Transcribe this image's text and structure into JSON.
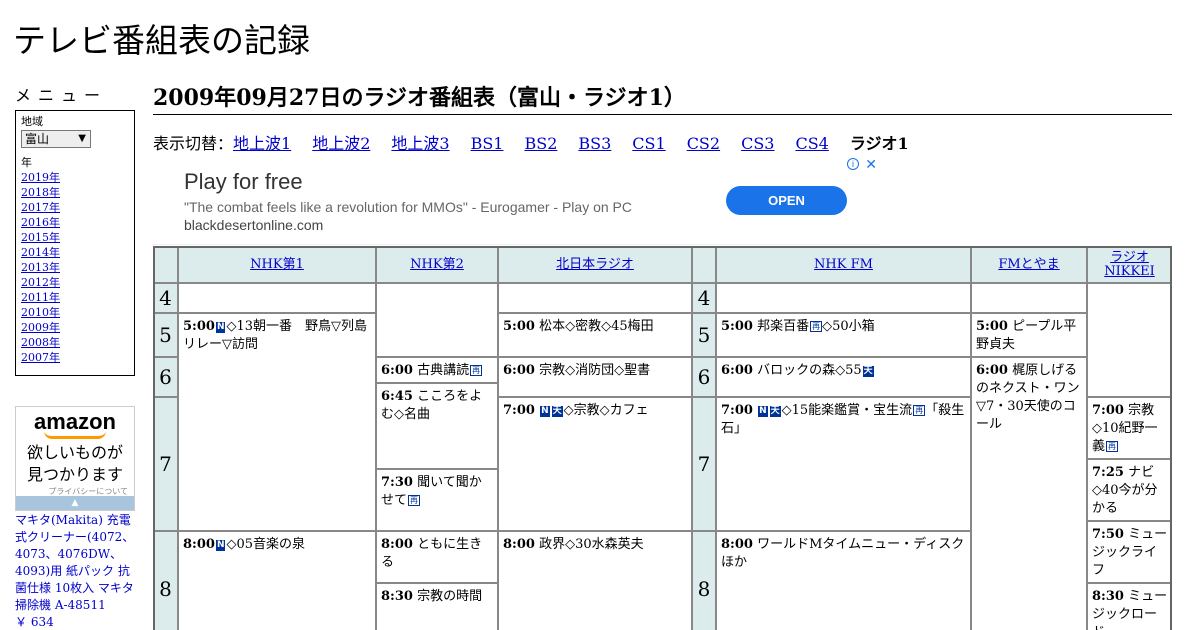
{
  "site": {
    "title": "テレビ番組表の記録"
  },
  "sidebar": {
    "menu_title": "メニュー",
    "region_label": "地域",
    "region_selected": "富山",
    "year_label": "年",
    "years": [
      "2019年",
      "2018年",
      "2017年",
      "2016年",
      "2015年",
      "2014年",
      "2013年",
      "2012年",
      "2011年",
      "2010年",
      "2009年",
      "2008年",
      "2007年"
    ]
  },
  "amazon_ad": {
    "logo": "amazon",
    "copy_line1": "欲しいものが",
    "copy_line2": "見つかります",
    "privacy": "プライバシーについて",
    "arrow": "▲"
  },
  "product": {
    "name": "マキタ(Makita) 充電式クリーナー(4072、4073、4076DW、4093)用 紙パック 抗菌仕様 10枚入 マキタ 掃除機 A-48511",
    "price": "￥ 634"
  },
  "main": {
    "heading": "2009年09月27日のラジオ番組表（富山・ラジオ1）",
    "switch_label": "表示切替：",
    "switch_links": [
      "地上波1",
      "地上波2",
      "地上波3",
      "BS1",
      "BS2",
      "BS3",
      "CS1",
      "CS2",
      "CS3",
      "CS4"
    ],
    "switch_current": "ラジオ1"
  },
  "ad_banner": {
    "title": "Play for free",
    "quote": "\"The combat feels like a revolution for MMOs\" - Eurogamer - Play on PC",
    "url": "blackdesertonline.com",
    "button": "OPEN",
    "info_icon": "i",
    "close_icon": "✕"
  },
  "schedule": {
    "channels": [
      "NHK第1",
      "NHK第2",
      "北日本ラジオ",
      "NHK FM",
      "FMとやま",
      "ラジオNIKKEI"
    ],
    "channel_ni_line1": "ラジオ",
    "channel_ni_line2": "NIKKEI",
    "hours": [
      "4",
      "5",
      "6",
      "7",
      "8"
    ],
    "icons": {
      "news": "N",
      "weather": "天",
      "rerun": "再"
    },
    "programs": {
      "nhk1_500_time": "5:00",
      "nhk1_500_text": "◇13朝一番　野鳥▽列島リレー▽訪問",
      "nhk1_800_time": "8:00",
      "nhk1_800_text": "◇05音楽の泉",
      "nhk2_600_time": "6:00",
      "nhk2_600_text": "古典講読",
      "nhk2_645_time": "6:45",
      "nhk2_645_text": "こころをよむ◇名曲",
      "nhk2_730_time": "7:30",
      "nhk2_730_text": "聞いて聞かせて",
      "nhk2_800_time": "8:00",
      "nhk2_800_text": "ともに生きる",
      "nhk2_830_time": "8:30",
      "nhk2_830_text": "宗教の時間",
      "kn_500_time": "5:00",
      "kn_500_text": "松本◇密教◇45梅田",
      "kn_600_time": "6:00",
      "kn_600_text": "宗教◇消防団◇聖書",
      "kn_700_time": "7:00",
      "kn_700_text": "◇宗教◇カフェ",
      "kn_800_time": "8:00",
      "kn_800_text": "政界◇30水森英夫",
      "fm_500_time": "5:00",
      "fm_500_text": "邦楽百番",
      "fm_500_text2": "◇50小箱",
      "fm_600_time": "6:00",
      "fm_600_text": "バロックの森◇55",
      "fm_700_time": "7:00",
      "fm_700_text": "◇15能楽鑑賞・宝生流",
      "fm_700_text2": "「殺生石」",
      "fm_800_time": "8:00",
      "fm_800_text": "ワールドMタイムニュー・ディスクほか",
      "fmt_500_time": "5:00",
      "fmt_500_text": "ピープル平野貞夫",
      "fmt_600_time": "6:00",
      "fmt_600_text": "梶原しげるのネクスト・ワン▽7・30天使のコール",
      "ni_700_time": "7:00",
      "ni_700_text": "宗教◇10紀野一義",
      "ni_725_time": "7:25",
      "ni_725_text": "ナビ◇40今が分かる",
      "ni_750_time": "7:50",
      "ni_750_text": "ミュージックライフ",
      "ni_830_time": "8:30",
      "ni_830_text": "ミュージックロード"
    }
  }
}
